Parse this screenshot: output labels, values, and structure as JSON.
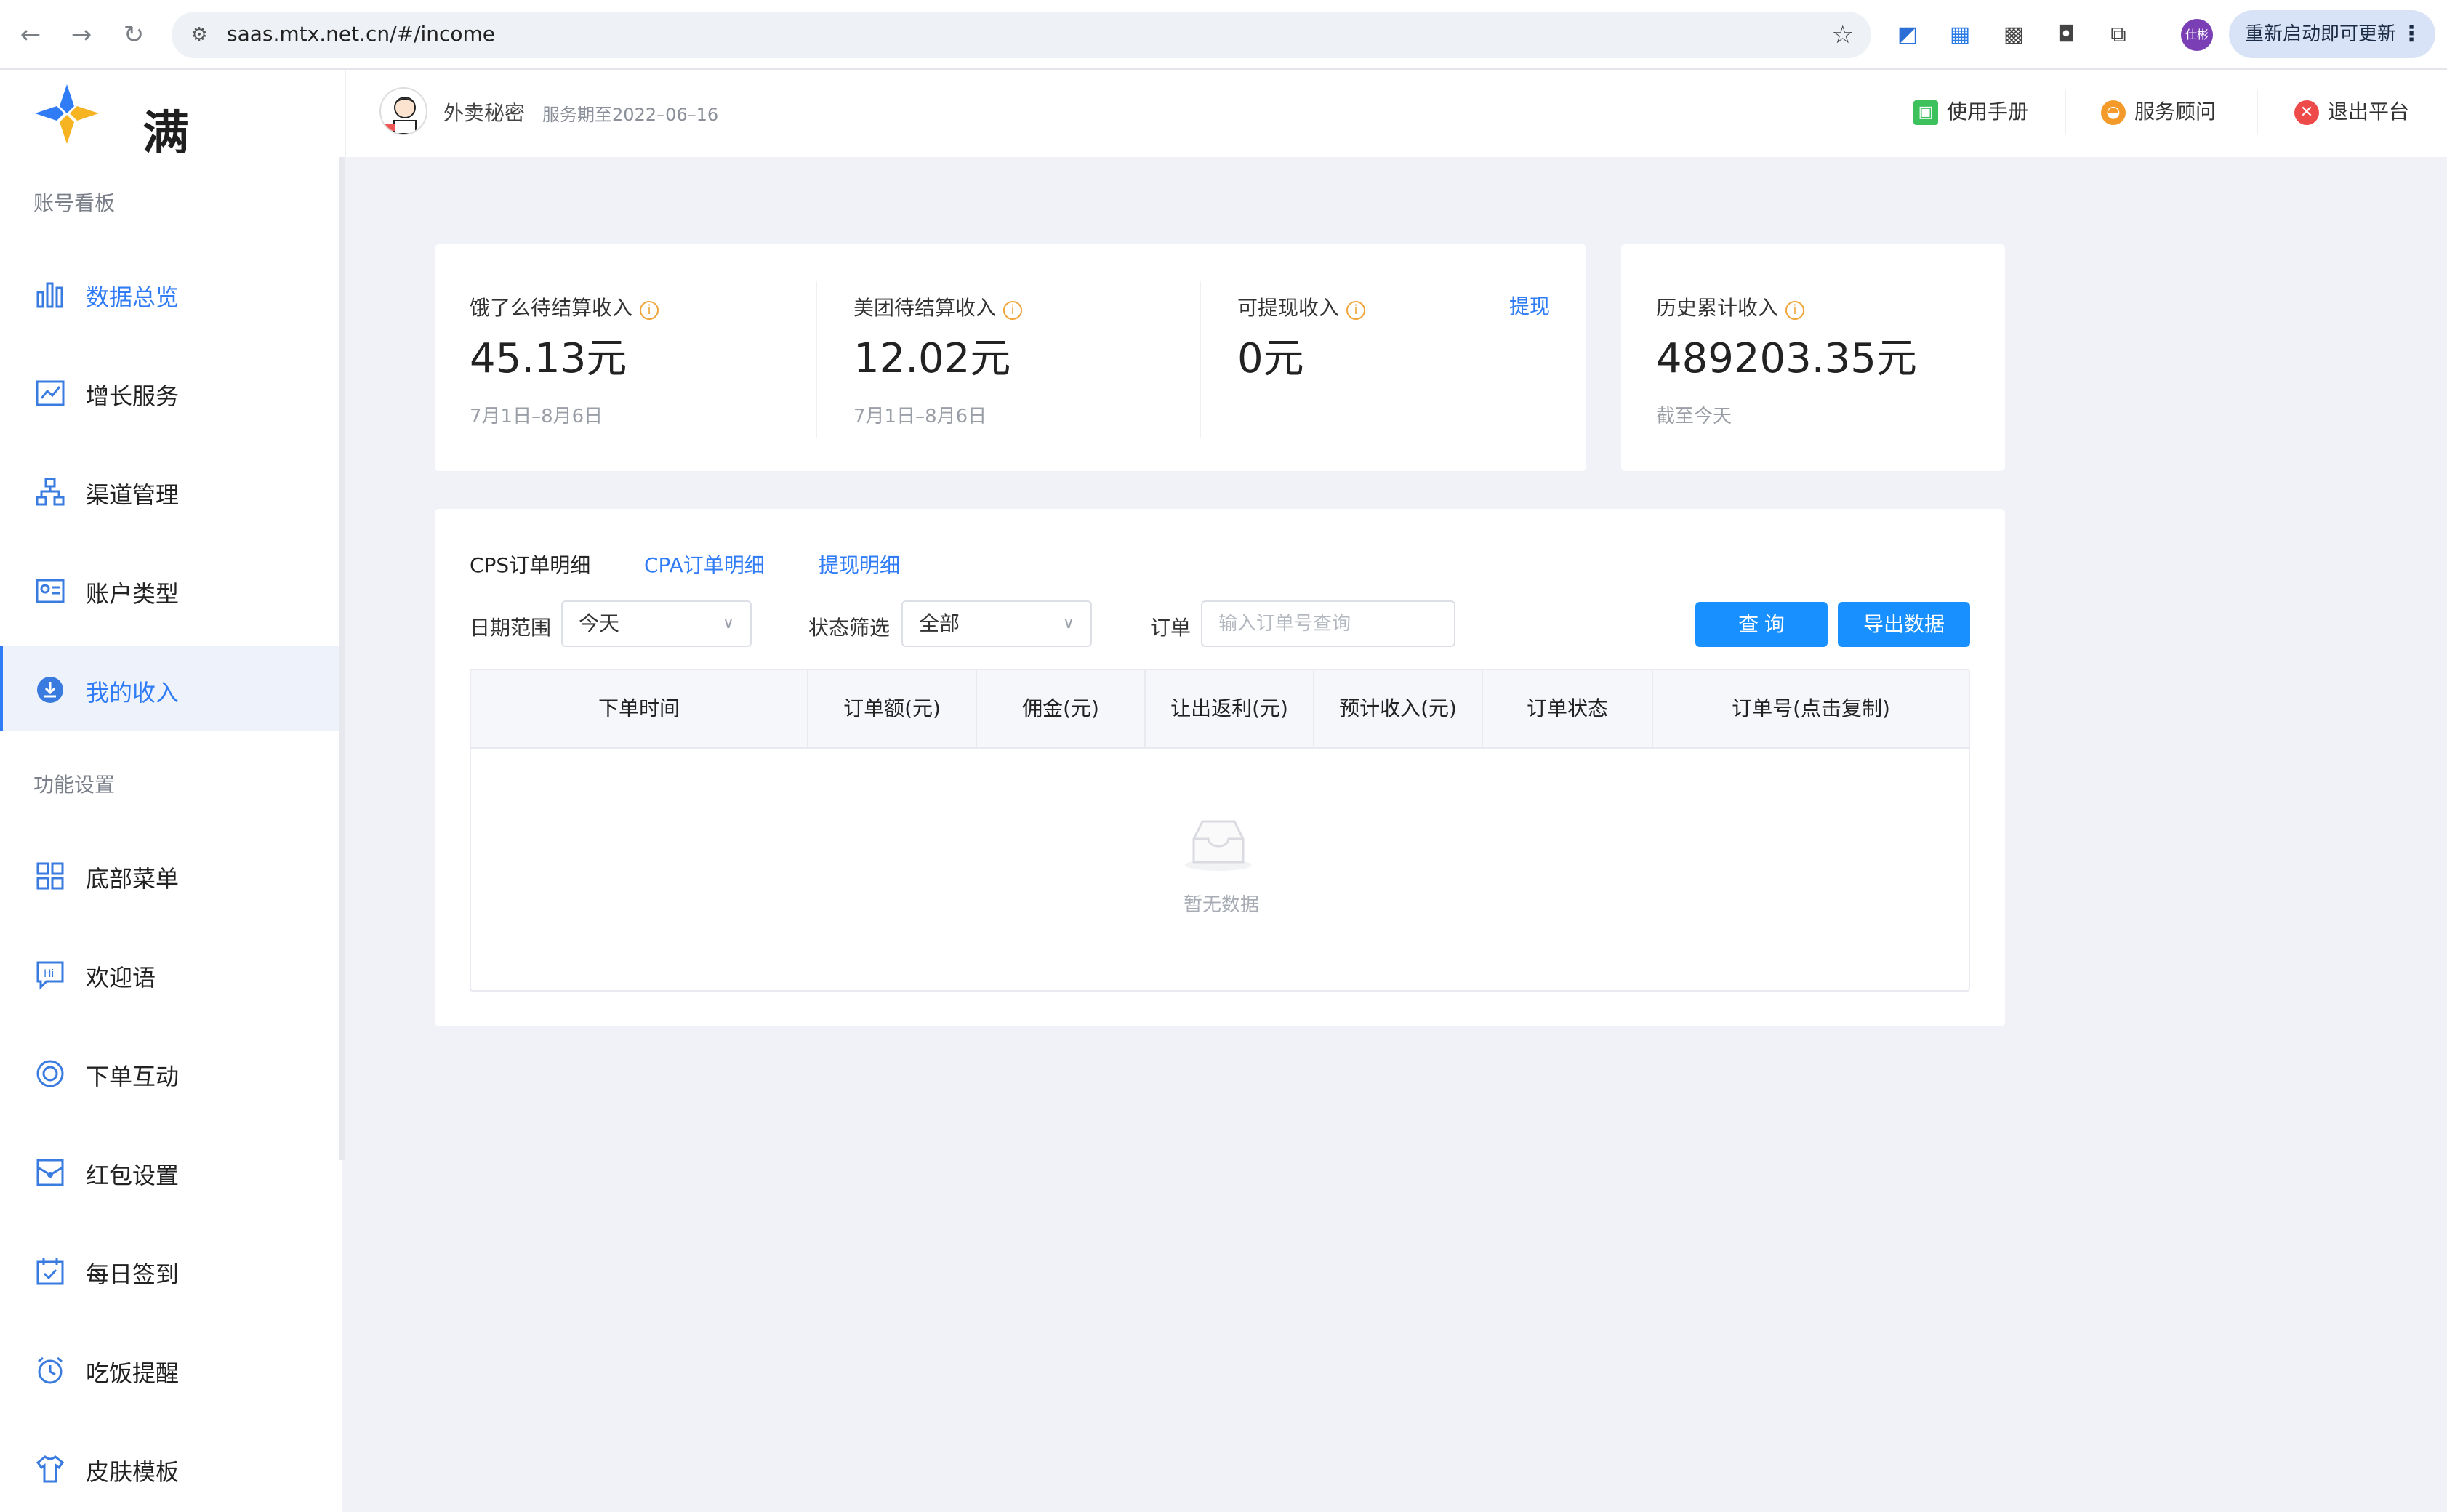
{
  "browser": {
    "url": "saas.mtx.net.cn/#/income",
    "profile_label": "仕彬",
    "update_label": "重新启动即可更新"
  },
  "header": {
    "logo_text": "满天星",
    "shop_name": "外卖秘密",
    "service_period": "服务期至2022–06–16",
    "links": {
      "manual": "使用手册",
      "advisor": "服务顾问",
      "logout": "退出平台"
    }
  },
  "sidebar": {
    "section1": "账号看板",
    "section2": "功能设置",
    "items": [
      {
        "label": "数据总览",
        "icon": "bar-chart-icon"
      },
      {
        "label": "增长服务",
        "icon": "trend-chart-icon"
      },
      {
        "label": "渠道管理",
        "icon": "hierarchy-icon"
      },
      {
        "label": "账户类型",
        "icon": "id-card-icon"
      },
      {
        "label": "我的收入",
        "icon": "download-circle-icon"
      },
      {
        "label": "底部菜单",
        "icon": "grid-icon"
      },
      {
        "label": "欢迎语",
        "icon": "hi-chat-icon"
      },
      {
        "label": "下单互动",
        "icon": "target-icon"
      },
      {
        "label": "红包设置",
        "icon": "red-envelope-icon"
      },
      {
        "label": "每日签到",
        "icon": "calendar-check-icon"
      },
      {
        "label": "吃饭提醒",
        "icon": "alarm-clock-icon"
      },
      {
        "label": "皮肤模板",
        "icon": "tshirt-icon"
      }
    ],
    "active_index": 4
  },
  "stats": {
    "eleme": {
      "label": "饿了么待结算收入",
      "value": "45.13元",
      "sub": "7月1日–8月6日"
    },
    "meituan": {
      "label": "美团待结算收入",
      "value": "12.02元",
      "sub": "7月1日–8月6日"
    },
    "withdrawable": {
      "label": "可提现收入",
      "value": "0元",
      "action": "提现"
    },
    "history": {
      "label": "历史累计收入",
      "value": "489203.35元",
      "sub": "截至今天"
    }
  },
  "tabs": [
    "CPS订单明细",
    "CPA订单明细",
    "提现明细"
  ],
  "filters": {
    "date_label": "日期范围",
    "date_value": "今天",
    "status_label": "状态筛选",
    "status_value": "全部",
    "order_label": "订单",
    "order_placeholder": "输入订单号查询",
    "query_button": "查 询",
    "export_button": "导出数据"
  },
  "table": {
    "columns": [
      "下单时间",
      "订单额(元)",
      "佣金(元)",
      "让出返利(元)",
      "预计收入(元)",
      "订单状态",
      "订单号(点击复制)"
    ],
    "rows": [],
    "empty_text": "暂无数据"
  },
  "colors": {
    "primary": "#1890ff",
    "accent_text": "#2f7cf6",
    "info_orange": "#f0a53a",
    "page_bg": "#f0f2f8"
  }
}
